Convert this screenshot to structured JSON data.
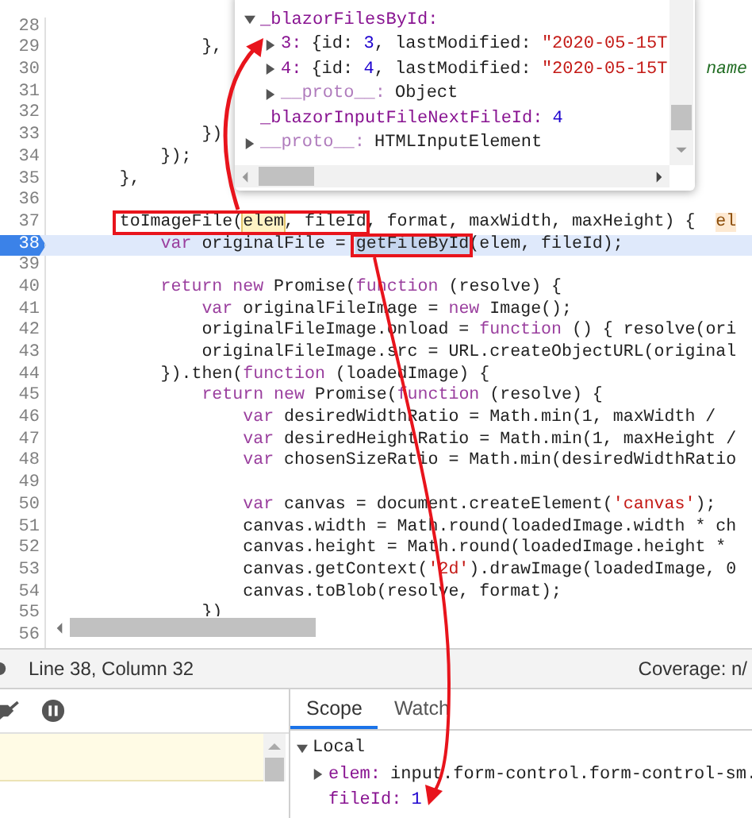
{
  "editor": {
    "lines": [
      {
        "number": "28",
        "current": false
      },
      {
        "number": "29",
        "current": false,
        "tokens": [
          {
            "kind": "plain",
            "text": "               },"
          }
        ]
      },
      {
        "number": "30",
        "current": false,
        "tokens": [
          {
            "kind": "prop",
            "text": "name"
          }
        ]
      },
      {
        "number": "31",
        "current": false
      },
      {
        "number": "32",
        "current": false
      },
      {
        "number": "33",
        "current": false,
        "tokens": [
          {
            "kind": "plain",
            "text": "               })"
          }
        ]
      },
      {
        "number": "34",
        "current": false,
        "tokens": [
          {
            "kind": "plain",
            "text": "           });"
          }
        ]
      },
      {
        "number": "35",
        "current": false,
        "tokens": [
          {
            "kind": "plain",
            "text": "       },"
          }
        ]
      },
      {
        "number": "36",
        "current": false
      },
      {
        "number": "37",
        "current": false,
        "tokens": [
          {
            "kind": "plain",
            "text": "       toImageFile("
          },
          {
            "kind": "hover",
            "text": "elem"
          },
          {
            "kind": "plain",
            "text": ", fileId, format, maxWidth, maxHeight) {  "
          },
          {
            "kind": "inline",
            "text": "el"
          }
        ]
      },
      {
        "number": "38",
        "current": true,
        "tokens": [
          {
            "kind": "kw",
            "text": "           var"
          },
          {
            "kind": "plain",
            "text": " originalFile = "
          },
          {
            "kind": "sel",
            "text": "getFileById"
          },
          {
            "kind": "plain",
            "text": "(elem, fileId);"
          }
        ]
      },
      {
        "number": "39",
        "current": false
      },
      {
        "number": "40",
        "current": false,
        "tokens": [
          {
            "kind": "kw",
            "text": "           return new"
          },
          {
            "kind": "plain",
            "text": " Promise("
          },
          {
            "kind": "kw",
            "text": "function"
          },
          {
            "kind": "plain",
            "text": " (resolve) {"
          }
        ]
      },
      {
        "number": "41",
        "current": false,
        "tokens": [
          {
            "kind": "kw",
            "text": "               var"
          },
          {
            "kind": "plain",
            "text": " originalFileImage = "
          },
          {
            "kind": "kw",
            "text": "new"
          },
          {
            "kind": "plain",
            "text": " Image();"
          }
        ]
      },
      {
        "number": "42",
        "current": false,
        "tokens": [
          {
            "kind": "plain",
            "text": "               originalFileImage.onload = "
          },
          {
            "kind": "kw",
            "text": "function"
          },
          {
            "kind": "plain",
            "text": " () { resolve(ori"
          }
        ]
      },
      {
        "number": "43",
        "current": false,
        "tokens": [
          {
            "kind": "plain",
            "text": "               originalFileImage.src = URL.createObjectURL(original"
          }
        ]
      },
      {
        "number": "44",
        "current": false,
        "tokens": [
          {
            "kind": "plain",
            "text": "           }).then("
          },
          {
            "kind": "kw",
            "text": "function"
          },
          {
            "kind": "plain",
            "text": " (loadedImage) {"
          }
        ]
      },
      {
        "number": "45",
        "current": false,
        "tokens": [
          {
            "kind": "kw",
            "text": "               return new"
          },
          {
            "kind": "plain",
            "text": " Promise("
          },
          {
            "kind": "kw",
            "text": "function"
          },
          {
            "kind": "plain",
            "text": " (resolve) {"
          }
        ]
      },
      {
        "number": "46",
        "current": false,
        "tokens": [
          {
            "kind": "kw",
            "text": "                   var"
          },
          {
            "kind": "plain",
            "text": " desiredWidthRatio = Math.min(1, maxWidth /"
          }
        ]
      },
      {
        "number": "47",
        "current": false,
        "tokens": [
          {
            "kind": "kw",
            "text": "                   var"
          },
          {
            "kind": "plain",
            "text": " desiredHeightRatio = Math.min(1, maxHeight /"
          }
        ]
      },
      {
        "number": "48",
        "current": false,
        "tokens": [
          {
            "kind": "kw",
            "text": "                   var"
          },
          {
            "kind": "plain",
            "text": " chosenSizeRatio = Math.min(desiredWidthRatio"
          }
        ]
      },
      {
        "number": "49",
        "current": false
      },
      {
        "number": "50",
        "current": false,
        "tokens": [
          {
            "kind": "kw",
            "text": "                   var"
          },
          {
            "kind": "plain",
            "text": " canvas = document.createElement("
          },
          {
            "kind": "str",
            "text": "'canvas'"
          },
          {
            "kind": "plain",
            "text": ");"
          }
        ]
      },
      {
        "number": "51",
        "current": false,
        "tokens": [
          {
            "kind": "plain",
            "text": "                   canvas.width = Math.round(loadedImage.width * ch"
          }
        ]
      },
      {
        "number": "52",
        "current": false,
        "tokens": [
          {
            "kind": "plain",
            "text": "                   canvas.height = Math.round(loadedImage.height *"
          }
        ]
      },
      {
        "number": "53",
        "current": false,
        "tokens": [
          {
            "kind": "plain",
            "text": "                   canvas.getContext("
          },
          {
            "kind": "str",
            "text": "'2d'"
          },
          {
            "kind": "plain",
            "text": ").drawImage(loadedImage, 0"
          }
        ]
      },
      {
        "number": "54",
        "current": false,
        "tokens": [
          {
            "kind": "plain",
            "text": "                   canvas.toBlob(resolve, format);"
          }
        ]
      },
      {
        "number": "55",
        "current": false,
        "tokens": [
          {
            "kind": "plain",
            "text": "               })"
          }
        ]
      },
      {
        "number": "56",
        "current": false
      }
    ]
  },
  "popover": {
    "tree": [
      {
        "key": "_blazorFilesById:",
        "dim": false,
        "expanded": true,
        "children": [
          {
            "key": "3:",
            "dim": false,
            "expanded": false,
            "value": [
              {
                "kind": "plain",
                "text": "{id: "
              },
              {
                "kind": "num",
                "text": "3"
              },
              {
                "kind": "plain",
                "text": ", lastModified: "
              },
              {
                "kind": "str",
                "text": "\"2020-05-15T"
              }
            ]
          },
          {
            "key": "4:",
            "dim": false,
            "expanded": false,
            "value": [
              {
                "kind": "plain",
                "text": "{id: "
              },
              {
                "kind": "num",
                "text": "4"
              },
              {
                "kind": "plain",
                "text": ", lastModified: "
              },
              {
                "kind": "str",
                "text": "\"2020-05-15T"
              }
            ]
          },
          {
            "key": "__proto__:",
            "dim": true,
            "expanded": false,
            "value": [
              {
                "kind": "plain",
                "text": "Object"
              }
            ]
          }
        ]
      },
      {
        "key": "_blazorInputFileNextFileId:",
        "dim": false,
        "value": [
          {
            "kind": "num",
            "text": "4"
          }
        ]
      },
      {
        "key": "__proto__:",
        "dim": true,
        "expanded": false,
        "value": [
          {
            "kind": "plain",
            "text": "HTMLInputElement"
          }
        ]
      }
    ]
  },
  "status_bar": {
    "position": "Line 38, Column 32",
    "coverage": "Coverage: n/"
  },
  "scope": {
    "tabs": [
      {
        "label": "Scope",
        "selected": true
      },
      {
        "label": "Watch",
        "selected": false
      }
    ],
    "tree": [
      {
        "key": "Local",
        "expanded": true,
        "children": [
          {
            "key": "elem:",
            "expanded": false,
            "value": [
              {
                "kind": "plain",
                "text": "input.form-control.form-control-sm."
              }
            ]
          },
          {
            "key": "fileId:",
            "value": [
              {
                "kind": "num",
                "text": "1"
              }
            ]
          }
        ]
      }
    ]
  }
}
